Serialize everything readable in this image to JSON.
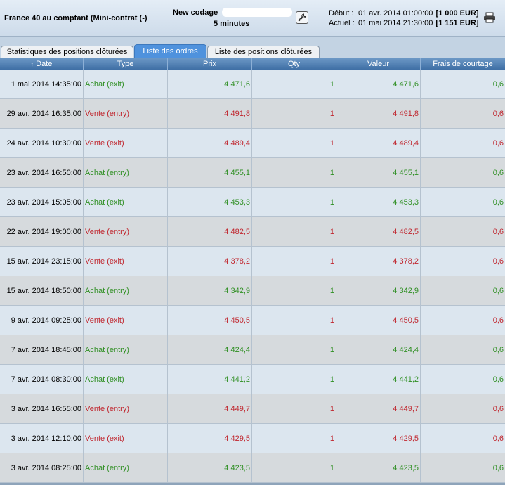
{
  "header": {
    "instrument": "France 40 au comptant (Mini-contrat  (-)",
    "codage_label": "New codage",
    "codage_interval": "5 minutes",
    "settings_icon": "wrench-icon",
    "debut_label": "Début :",
    "debut_value": "01 avr. 2014 01:00:00",
    "debut_amount": "[1 000 EUR]",
    "actuel_label": "Actuel :",
    "actuel_value": "01 mai 2014 21:30:00",
    "actuel_amount": "[1 151 EUR]",
    "print_icon": "printer-icon"
  },
  "tabs": [
    {
      "label": "Statistiques des positions clôturées",
      "active": false
    },
    {
      "label": "Liste des ordres",
      "active": true
    },
    {
      "label": "Liste des positions clôturées",
      "active": false
    }
  ],
  "table": {
    "headers": [
      "Date",
      "Type",
      "Prix",
      "Qty",
      "Valeur",
      "Frais de courtage"
    ],
    "rows": [
      {
        "date": "1 mai 2014 14:35:00",
        "type": "Achat (exit)",
        "prix": "4 471,6",
        "qty": "1",
        "valeur": "4 471,6",
        "frais": "0,6"
      },
      {
        "date": "29 avr. 2014 16:35:00",
        "type": "Vente (entry)",
        "prix": "4 491,8",
        "qty": "1",
        "valeur": "4 491,8",
        "frais": "0,6"
      },
      {
        "date": "24 avr. 2014 10:30:00",
        "type": "Vente (exit)",
        "prix": "4 489,4",
        "qty": "1",
        "valeur": "4 489,4",
        "frais": "0,6"
      },
      {
        "date": "23 avr. 2014 16:50:00",
        "type": "Achat (entry)",
        "prix": "4 455,1",
        "qty": "1",
        "valeur": "4 455,1",
        "frais": "0,6"
      },
      {
        "date": "23 avr. 2014 15:05:00",
        "type": "Achat (exit)",
        "prix": "4 453,3",
        "qty": "1",
        "valeur": "4 453,3",
        "frais": "0,6"
      },
      {
        "date": "22 avr. 2014 19:00:00",
        "type": "Vente (entry)",
        "prix": "4 482,5",
        "qty": "1",
        "valeur": "4 482,5",
        "frais": "0,6"
      },
      {
        "date": "15 avr. 2014 23:15:00",
        "type": "Vente (exit)",
        "prix": "4 378,2",
        "qty": "1",
        "valeur": "4 378,2",
        "frais": "0,6"
      },
      {
        "date": "15 avr. 2014 18:50:00",
        "type": "Achat (entry)",
        "prix": "4 342,9",
        "qty": "1",
        "valeur": "4 342,9",
        "frais": "0,6"
      },
      {
        "date": "9 avr. 2014 09:25:00",
        "type": "Vente (exit)",
        "prix": "4 450,5",
        "qty": "1",
        "valeur": "4 450,5",
        "frais": "0,6"
      },
      {
        "date": "7 avr. 2014 18:45:00",
        "type": "Achat (entry)",
        "prix": "4 424,4",
        "qty": "1",
        "valeur": "4 424,4",
        "frais": "0,6"
      },
      {
        "date": "7 avr. 2014 08:30:00",
        "type": "Achat (exit)",
        "prix": "4 441,2",
        "qty": "1",
        "valeur": "4 441,2",
        "frais": "0,6"
      },
      {
        "date": "3 avr. 2014 16:55:00",
        "type": "Vente (entry)",
        "prix": "4 449,7",
        "qty": "1",
        "valeur": "4 449,7",
        "frais": "0,6"
      },
      {
        "date": "3 avr. 2014 12:10:00",
        "type": "Vente (exit)",
        "prix": "4 429,5",
        "qty": "1",
        "valeur": "4 429,5",
        "frais": "0,6"
      },
      {
        "date": "3 avr. 2014 08:25:00",
        "type": "Achat (entry)",
        "prix": "4 423,5",
        "qty": "1",
        "valeur": "4 423,5",
        "frais": "0,6"
      }
    ]
  },
  "colors": {
    "buy": "#2f8f23",
    "sell": "#c0262e",
    "active_tab": "#4f92dd",
    "header_bar": "#3f6fa5"
  }
}
